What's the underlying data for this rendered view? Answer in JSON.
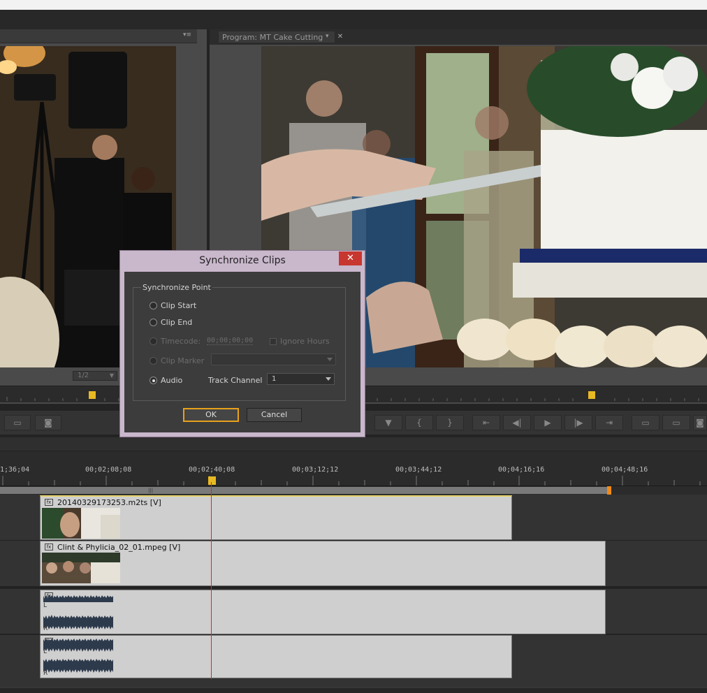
{
  "source_monitor": {
    "zoom_value": "1/2"
  },
  "program_monitor": {
    "tab_label": "Program: MT Cake Cutting"
  },
  "timeline": {
    "ruler_labels": [
      "1;36;04",
      "00;02;08;08",
      "00;02;40;08",
      "00;03;12;12",
      "00;03;44;12",
      "00;04;16;16",
      "00;04;48;16"
    ],
    "video_clips": [
      {
        "name": "20140329173253.m2ts [V]"
      },
      {
        "name": "Clint & Phylicia_02_01.mpeg [V]"
      }
    ],
    "audio_channel_labels": [
      "L",
      "R",
      "L",
      "R"
    ]
  },
  "dialog": {
    "title": "Synchronize Clips",
    "close_glyph": "✕",
    "group_label": "Synchronize Point",
    "options": {
      "clip_start": "Clip Start",
      "clip_end": "Clip End",
      "timecode": "Timecode:",
      "timecode_value": "00;00;00;00",
      "ignore_hours": "Ignore Hours",
      "clip_marker": "Clip Marker",
      "audio": "Audio",
      "track_channel_label": "Track Channel",
      "track_channel_value": "1"
    },
    "ok_label": "OK",
    "cancel_label": "Cancel"
  },
  "colors": {
    "playhead": "#e0261f",
    "dialog_frame": "#c9b7cc",
    "close": "#c7372f",
    "ok_focus": "#e8a21b"
  }
}
